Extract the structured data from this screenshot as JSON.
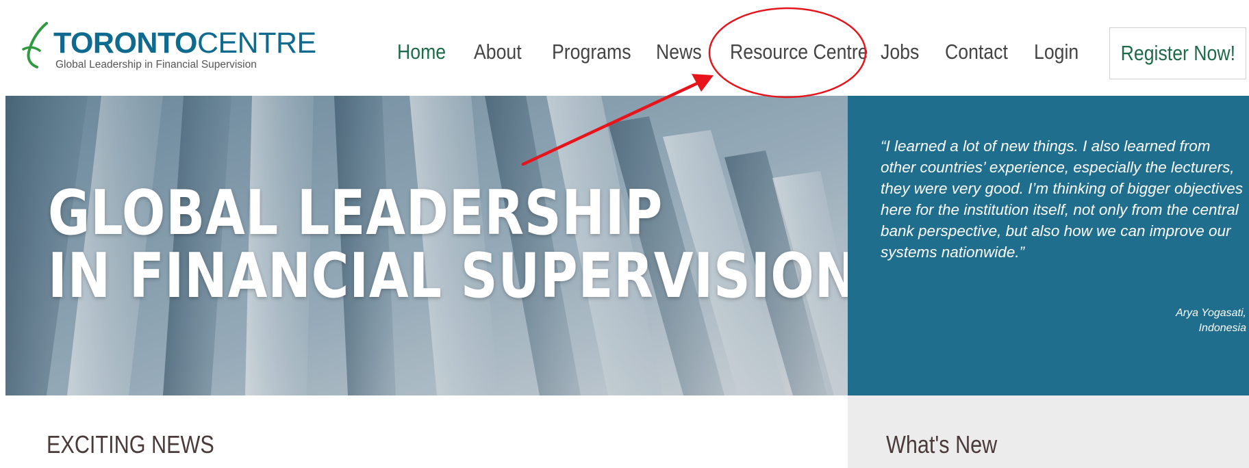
{
  "logo": {
    "word_bold": "TORONTO",
    "word_light": "CENTRE",
    "tagline": "Global Leadership in Financial Supervision",
    "icon": "leaf-swoosh-icon"
  },
  "nav": {
    "items": [
      {
        "label": "Home",
        "active": true
      },
      {
        "label": "About",
        "active": false
      },
      {
        "label": "Programs",
        "active": false
      },
      {
        "label": "News",
        "active": false
      },
      {
        "label": "Resource Centre",
        "active": false
      },
      {
        "label": "Jobs",
        "active": false
      },
      {
        "label": "Contact",
        "active": false
      },
      {
        "label": "Login",
        "active": false
      }
    ],
    "register_label": "Register Now!"
  },
  "hero": {
    "line1": "GLOBAL LEADERSHIP",
    "line2": "IN FINANCIAL SUPERVISION"
  },
  "testimonial": {
    "quote": "“I learned a lot of new things. I also learned from other countries’ experience, especially the lecturers, they were very good. I’m thinking of bigger objectives here for the institution itself, not only from the central bank perspective, but also how we can improve our systems nationwide.”",
    "author_name": "Arya Yogasati,",
    "author_country": "Indonesia"
  },
  "sections": {
    "news_heading": "EXCITING NEWS",
    "whats_new_heading": "What's New"
  },
  "colors": {
    "brand_blue": "#0f6a8f",
    "brand_green": "#1d6b4a",
    "panel_teal": "#1f6e8d",
    "annotation_red": "#e8141b"
  }
}
